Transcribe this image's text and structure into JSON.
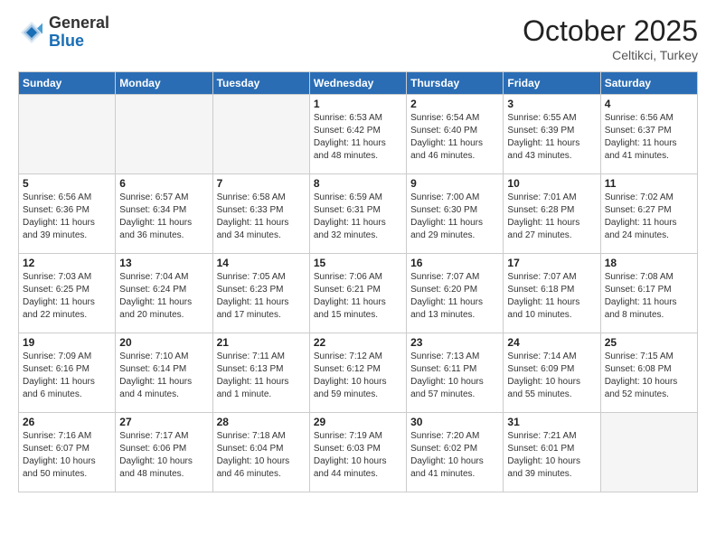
{
  "header": {
    "logo_general": "General",
    "logo_blue": "Blue",
    "month_title": "October 2025",
    "location": "Celtikci, Turkey"
  },
  "weekdays": [
    "Sunday",
    "Monday",
    "Tuesday",
    "Wednesday",
    "Thursday",
    "Friday",
    "Saturday"
  ],
  "weeks": [
    [
      {
        "day": "",
        "info": ""
      },
      {
        "day": "",
        "info": ""
      },
      {
        "day": "",
        "info": ""
      },
      {
        "day": "1",
        "info": "Sunrise: 6:53 AM\nSunset: 6:42 PM\nDaylight: 11 hours\nand 48 minutes."
      },
      {
        "day": "2",
        "info": "Sunrise: 6:54 AM\nSunset: 6:40 PM\nDaylight: 11 hours\nand 46 minutes."
      },
      {
        "day": "3",
        "info": "Sunrise: 6:55 AM\nSunset: 6:39 PM\nDaylight: 11 hours\nand 43 minutes."
      },
      {
        "day": "4",
        "info": "Sunrise: 6:56 AM\nSunset: 6:37 PM\nDaylight: 11 hours\nand 41 minutes."
      }
    ],
    [
      {
        "day": "5",
        "info": "Sunrise: 6:56 AM\nSunset: 6:36 PM\nDaylight: 11 hours\nand 39 minutes."
      },
      {
        "day": "6",
        "info": "Sunrise: 6:57 AM\nSunset: 6:34 PM\nDaylight: 11 hours\nand 36 minutes."
      },
      {
        "day": "7",
        "info": "Sunrise: 6:58 AM\nSunset: 6:33 PM\nDaylight: 11 hours\nand 34 minutes."
      },
      {
        "day": "8",
        "info": "Sunrise: 6:59 AM\nSunset: 6:31 PM\nDaylight: 11 hours\nand 32 minutes."
      },
      {
        "day": "9",
        "info": "Sunrise: 7:00 AM\nSunset: 6:30 PM\nDaylight: 11 hours\nand 29 minutes."
      },
      {
        "day": "10",
        "info": "Sunrise: 7:01 AM\nSunset: 6:28 PM\nDaylight: 11 hours\nand 27 minutes."
      },
      {
        "day": "11",
        "info": "Sunrise: 7:02 AM\nSunset: 6:27 PM\nDaylight: 11 hours\nand 24 minutes."
      }
    ],
    [
      {
        "day": "12",
        "info": "Sunrise: 7:03 AM\nSunset: 6:25 PM\nDaylight: 11 hours\nand 22 minutes."
      },
      {
        "day": "13",
        "info": "Sunrise: 7:04 AM\nSunset: 6:24 PM\nDaylight: 11 hours\nand 20 minutes."
      },
      {
        "day": "14",
        "info": "Sunrise: 7:05 AM\nSunset: 6:23 PM\nDaylight: 11 hours\nand 17 minutes."
      },
      {
        "day": "15",
        "info": "Sunrise: 7:06 AM\nSunset: 6:21 PM\nDaylight: 11 hours\nand 15 minutes."
      },
      {
        "day": "16",
        "info": "Sunrise: 7:07 AM\nSunset: 6:20 PM\nDaylight: 11 hours\nand 13 minutes."
      },
      {
        "day": "17",
        "info": "Sunrise: 7:07 AM\nSunset: 6:18 PM\nDaylight: 11 hours\nand 10 minutes."
      },
      {
        "day": "18",
        "info": "Sunrise: 7:08 AM\nSunset: 6:17 PM\nDaylight: 11 hours\nand 8 minutes."
      }
    ],
    [
      {
        "day": "19",
        "info": "Sunrise: 7:09 AM\nSunset: 6:16 PM\nDaylight: 11 hours\nand 6 minutes."
      },
      {
        "day": "20",
        "info": "Sunrise: 7:10 AM\nSunset: 6:14 PM\nDaylight: 11 hours\nand 4 minutes."
      },
      {
        "day": "21",
        "info": "Sunrise: 7:11 AM\nSunset: 6:13 PM\nDaylight: 11 hours\nand 1 minute."
      },
      {
        "day": "22",
        "info": "Sunrise: 7:12 AM\nSunset: 6:12 PM\nDaylight: 10 hours\nand 59 minutes."
      },
      {
        "day": "23",
        "info": "Sunrise: 7:13 AM\nSunset: 6:11 PM\nDaylight: 10 hours\nand 57 minutes."
      },
      {
        "day": "24",
        "info": "Sunrise: 7:14 AM\nSunset: 6:09 PM\nDaylight: 10 hours\nand 55 minutes."
      },
      {
        "day": "25",
        "info": "Sunrise: 7:15 AM\nSunset: 6:08 PM\nDaylight: 10 hours\nand 52 minutes."
      }
    ],
    [
      {
        "day": "26",
        "info": "Sunrise: 7:16 AM\nSunset: 6:07 PM\nDaylight: 10 hours\nand 50 minutes."
      },
      {
        "day": "27",
        "info": "Sunrise: 7:17 AM\nSunset: 6:06 PM\nDaylight: 10 hours\nand 48 minutes."
      },
      {
        "day": "28",
        "info": "Sunrise: 7:18 AM\nSunset: 6:04 PM\nDaylight: 10 hours\nand 46 minutes."
      },
      {
        "day": "29",
        "info": "Sunrise: 7:19 AM\nSunset: 6:03 PM\nDaylight: 10 hours\nand 44 minutes."
      },
      {
        "day": "30",
        "info": "Sunrise: 7:20 AM\nSunset: 6:02 PM\nDaylight: 10 hours\nand 41 minutes."
      },
      {
        "day": "31",
        "info": "Sunrise: 7:21 AM\nSunset: 6:01 PM\nDaylight: 10 hours\nand 39 minutes."
      },
      {
        "day": "",
        "info": ""
      }
    ]
  ]
}
